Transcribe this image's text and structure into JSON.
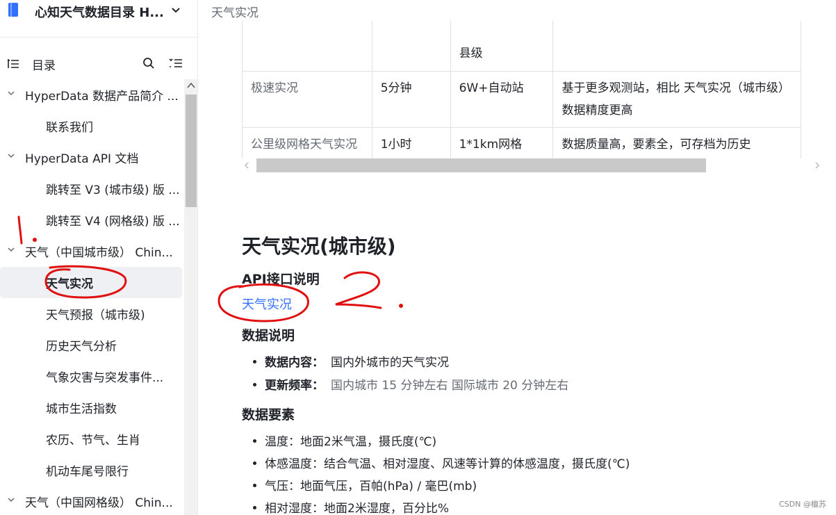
{
  "sidebar": {
    "book_title": "心知天气数据目录 H...",
    "toc_label": "目录",
    "items": [
      {
        "label": "HyperData 数据产品简介 ..."
      },
      {
        "label": "联系我们"
      },
      {
        "label": "HyperData API 文档"
      },
      {
        "label": "跳转至 V3 (城市级) 版 ..."
      },
      {
        "label": "跳转至 V4 (网格级) 版 ..."
      },
      {
        "label": "天气（中国城市级） Chin..."
      },
      {
        "label": "天气实况"
      },
      {
        "label": "天气预报（城市级)"
      },
      {
        "label": "历史天气分析"
      },
      {
        "label": "气象灾害与突发事件..."
      },
      {
        "label": "城市生活指数"
      },
      {
        "label": "农历、节气、生肖"
      },
      {
        "label": "机动车尾号限行"
      },
      {
        "label": "天气（中国网格级） Chin..."
      }
    ]
  },
  "topbar": {
    "breadcrumb": "天气实况"
  },
  "table": {
    "rows": [
      [
        "",
        "",
        "县级",
        ""
      ],
      [
        "极速实况",
        "5分钟",
        "6W+自动站",
        "基于更多观测站，相比 天气实况（城市级） 数据精度更高"
      ],
      [
        "公里级网格天气实况",
        "1小时",
        "1*1km网格",
        "数据质量高，要素全，可存档为历史"
      ]
    ]
  },
  "content": {
    "title": "天气实况(城市级)",
    "api_heading": "API接口说明",
    "api_link": "天气实况",
    "data_heading": "数据说明",
    "data_items": [
      {
        "key": "数据内容：",
        "value": "国内外城市的天气实况"
      },
      {
        "key": "更新频率：",
        "value": "国内城市 15 分钟左右 国际城市 20 分钟左右"
      }
    ],
    "elements_heading": "数据要素",
    "elements": [
      "温度：地面2米气温，摄氏度(℃)",
      "体感温度：结合气温、相对湿度、风速等计算的体感温度，摄氏度(℃)",
      "气压：地面气压，百帕(hPa) / 毫巴(mb)",
      "相对湿度：地面2米湿度，百分比%"
    ]
  },
  "annotations": {
    "mark1": "1.",
    "mark2": "2."
  },
  "watermark": "CSDN @檀苏",
  "colors": {
    "accent": "#3370ff",
    "annotation": "#e01010"
  }
}
